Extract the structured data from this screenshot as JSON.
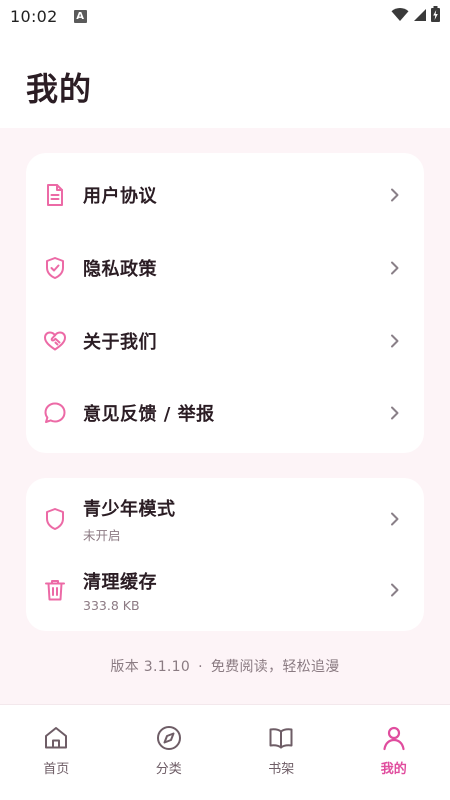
{
  "status_bar": {
    "time": "10:02",
    "notification_icon": "a-letter-icon"
  },
  "header": {
    "title": "我的"
  },
  "colors": {
    "accent": "#e04d9e",
    "icon_pink": "#ec6aa6",
    "text_primary": "#2b1d24",
    "text_secondary": "#8c7a83",
    "background": "#fdf4f7"
  },
  "menu_group_1": {
    "items": [
      {
        "label": "用户协议",
        "icon": "document-icon"
      },
      {
        "label": "隐私政策",
        "icon": "shield-check-icon"
      },
      {
        "label": "关于我们",
        "icon": "heart-handshake-icon"
      },
      {
        "label": "意见反馈 / 举报",
        "icon": "chat-bubble-icon"
      }
    ]
  },
  "menu_group_2": {
    "items": [
      {
        "label": "青少年模式",
        "sub": "未开启",
        "icon": "shield-icon"
      },
      {
        "label": "清理缓存",
        "sub": "333.8 KB",
        "icon": "trash-icon"
      }
    ]
  },
  "footer": {
    "version": "版本 3.1.10",
    "separator": "·",
    "slogan": "免费阅读，轻松追漫"
  },
  "bottom_nav": {
    "items": [
      {
        "label": "首页",
        "icon": "home-icon",
        "active": false
      },
      {
        "label": "分类",
        "icon": "compass-icon",
        "active": false
      },
      {
        "label": "书架",
        "icon": "book-icon",
        "active": false
      },
      {
        "label": "我的",
        "icon": "user-icon",
        "active": true
      }
    ]
  }
}
